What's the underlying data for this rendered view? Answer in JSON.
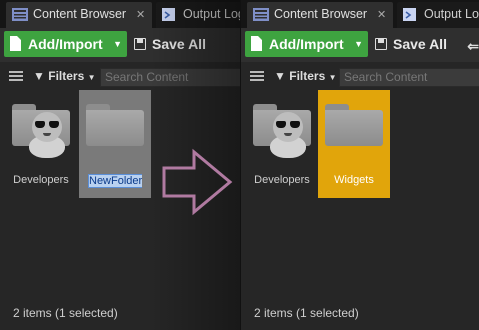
{
  "left_panel": {
    "tabs": [
      {
        "label": "Content Browser",
        "close": "✕",
        "icon": "content-browser-icon"
      },
      {
        "label": "Output Log",
        "icon": "output-log-icon"
      }
    ],
    "toolbar": {
      "add_import_label": "Add/Import",
      "save_all_label": "Save All"
    },
    "filter_bar": {
      "filters_label": "Filters",
      "search_placeholder": "Search Content"
    },
    "items": [
      {
        "name": "Developers",
        "type": "developers-folder"
      },
      {
        "name": "NewFolder",
        "type": "folder",
        "state": "selected-renaming"
      }
    ],
    "status": "2 items (1 selected)"
  },
  "right_panel": {
    "tabs": [
      {
        "label": "Content Browser",
        "close": "✕",
        "icon": "content-browser-icon"
      },
      {
        "label": "Output Log",
        "icon": "output-log-icon"
      }
    ],
    "toolbar": {
      "add_import_label": "Add/Import",
      "save_all_label": "Save All"
    },
    "filter_bar": {
      "filters_label": "Filters",
      "search_placeholder": "Search Content"
    },
    "items": [
      {
        "name": "Developers",
        "type": "developers-folder"
      },
      {
        "name": "Widgets",
        "type": "folder",
        "state": "highlighted"
      }
    ],
    "status": "2 items (1 selected)"
  },
  "colors": {
    "add_button": "#3ea340",
    "highlight": "#e1a50b",
    "selected": "#7a7a7a",
    "arrow": "#b07aa1"
  }
}
